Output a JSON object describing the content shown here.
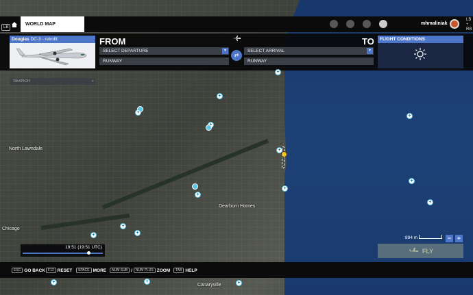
{
  "header": {
    "lb_label": "LB",
    "tab_label": "WORLD MAP",
    "username": "mhmaliniak",
    "rb_label": "LB\n+\nRB"
  },
  "aircraft": {
    "maker": "Douglas",
    "model": "DC-3 - retrofit"
  },
  "flight": {
    "from_label": "FROM",
    "to_label": "TO",
    "departure_placeholder": "SELECT DEPARTURE",
    "arrival_placeholder": "SELECT ARRIVAL",
    "runway_from": "RUNWAY",
    "runway_to": "RUNWAY"
  },
  "conditions": {
    "title": "FLIGHT CONDITIONS",
    "weather_icon": "sun-icon"
  },
  "search": {
    "placeholder": "SEARCH"
  },
  "map_labels": {
    "north_lawndale": "North Lawndale",
    "dearborn_homes": "Dearborn Homes",
    "chicago": "Chicago",
    "canaryville": "Canaryville"
  },
  "time": {
    "display": "19:51 (19:51 UTC)",
    "slider_fraction": 0.8
  },
  "scale": {
    "label": "894 m"
  },
  "fly_button": {
    "label": "FLY"
  },
  "bottom_keys": [
    {
      "key": "ESC",
      "label": "GO BACK"
    },
    {
      "key": "F12",
      "label": "RESET"
    },
    {
      "key": "SPACE",
      "label": "MORE"
    },
    {
      "key": "NUM SUB",
      "label": ""
    },
    {
      "key": "NUM PLUS",
      "label": "ZOOM"
    },
    {
      "key": "TAB",
      "label": "HELP"
    }
  ],
  "colors": {
    "accent": "#4d76c9",
    "lake": "#1d4177",
    "poi": "#5cc6e6",
    "origin_marker": "#f3c21b"
  }
}
